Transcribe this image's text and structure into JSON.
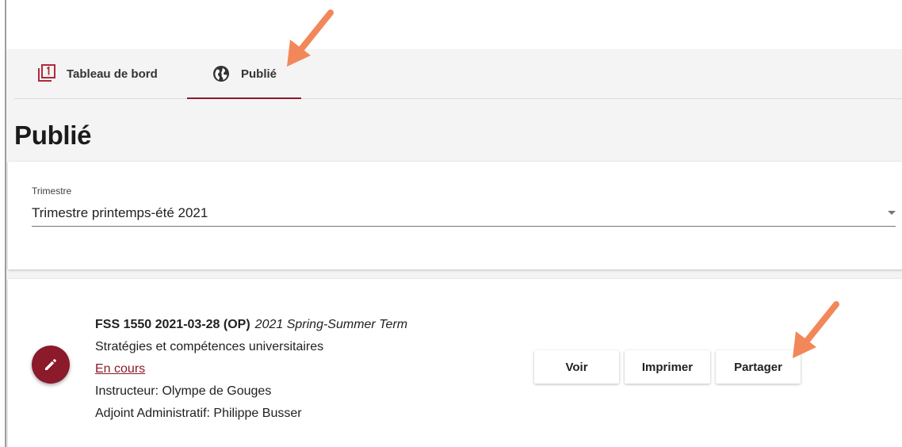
{
  "tabs": [
    {
      "label": "Tableau de bord",
      "icon": "filter-one-icon"
    },
    {
      "label": "Publié",
      "icon": "globe-icon",
      "active": true
    }
  ],
  "page": {
    "title": "Publié"
  },
  "term_select": {
    "label": "Trimestre",
    "value": "Trimestre printemps-été 2021"
  },
  "course": {
    "code": "FSS 1550 2021-03-28 (OP)",
    "term": "2021 Spring-Summer Term",
    "name": "Stratégies et compétences universitaires",
    "status": "En cours",
    "instructor": "Instructeur: Olympe de Gouges",
    "assistant": "Adjoint Administratif: Philippe Busser"
  },
  "actions": {
    "view": "Voir",
    "print": "Imprimer",
    "share": "Partager"
  },
  "colors": {
    "accent": "#8b1a2b",
    "annotation": "#f2875a"
  }
}
